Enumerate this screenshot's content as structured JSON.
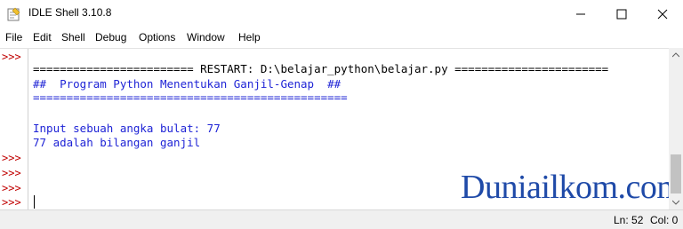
{
  "window": {
    "title": "IDLE Shell 3.10.8",
    "minimize_icon": "minimize-icon",
    "maximize_icon": "maximize-icon",
    "close_icon": "close-icon"
  },
  "menu": {
    "items": [
      "File",
      "Edit",
      "Shell",
      "Debug",
      "Options",
      "Window",
      "Help"
    ]
  },
  "shell": {
    "prompt": ">>>",
    "lines": {
      "restart": "======================== RESTART: D:\\belajar_python\\belajar.py =======================",
      "header": "##  Program Python Menentukan Ganjil-Genap  ##",
      "rule": "===============================================",
      "input": "Input sebuah angka bulat: 77",
      "output": "77 adalah bilangan ganjil"
    },
    "colors": {
      "prompt": "#c00000",
      "output": "#1f24d6",
      "restart": "#000000"
    }
  },
  "watermark": {
    "text": "Duniailkom.com"
  },
  "status": {
    "line": "Ln: 52",
    "col": "Col: 0"
  }
}
